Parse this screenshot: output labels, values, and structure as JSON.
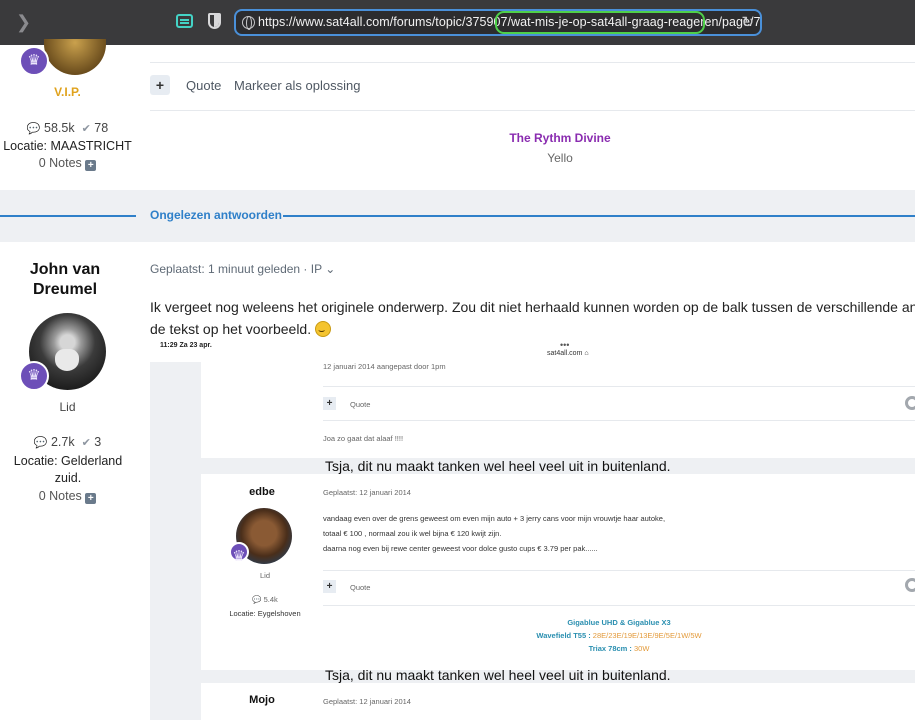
{
  "browser": {
    "url": "https://www.sat4all.com/forums/topic/375907/wat-mis-je-op-sat4all-graag-reageren/page/7",
    "url_prefix": "https://www.sat4all.com/forums/topic/375907/",
    "url_slug": "wat-mis-je-op-sat4all-graag-reageren/",
    "url_suffix": "page/7"
  },
  "prev_post": {
    "rank": "V.I.P.",
    "posts": "58.5k",
    "reputation": "78",
    "location": "Locatie: MAASTRICHT",
    "notes": "0 Notes",
    "actions": {
      "quote": "Quote",
      "mark_solution": "Markeer als oplossing"
    },
    "signature": {
      "line1": "The Rythm Divine",
      "line2": "Yello"
    }
  },
  "separator": {
    "label": "Ongelezen antwoorden"
  },
  "post": {
    "author": "John van Dreumel",
    "role": "Lid",
    "posts": "2.7k",
    "reputation": "3",
    "location": "Locatie: Gelderland zuid.",
    "notes": "0 Notes",
    "meta": "Geplaatst: 1 minuut geleden · IP ⌄",
    "body_line1": "Ik vergeet nog weleens het originele onderwerp. Zou dit niet herhaald kunnen worden op de balk tussen de verschillende antwoorden? K",
    "body_line2": "de tekst op het voorbeeld."
  },
  "screenshot": {
    "time": "11:29  Za 23 apr.",
    "dots": "•••",
    "host": "sat4all.com ⌂",
    "edited_note": "12 januari 2014 aangepast door 1pm",
    "quote": "Quote",
    "reply_text": "Joa zo gaat dat alaaf !!!!",
    "caption": "Tsja, dit nu maakt tanken wel heel veel uit in buitenland.",
    "edbe": {
      "author": "edbe",
      "meta": "Geplaatst: 12 januari 2014",
      "line1": "vandaag even over de grens geweest om even mijn auto + 3 jerry cans voor mijn vrouwtje haar autoke,",
      "line2": "totaal € 100 , normaal zou ik wel bijna € 120 kwijt zijn.",
      "line3": "daarna nog even bij rewe center geweest voor dolce gusto cups € 3.79 per pak......",
      "role": "Lid",
      "posts": "5.4k",
      "location": "Locatie: Eygelshoven",
      "sig_line1": "Gigablue UHD & Gigablue X3",
      "sig_line2_label": "Wavefield T55 : ",
      "sig_line2_value": "28E/23E/19E/13E/9E/5E/1W/5W",
      "sig_line3_label": "Triax 78cm : ",
      "sig_line3_value": "30W"
    },
    "mojo": {
      "author": "Mojo",
      "meta": "Geplaatst: 12 januari 2014"
    }
  },
  "colors": {
    "accent": "#2f80c9",
    "vip": "#e0a21c",
    "signature": "#8a2cb0",
    "url_highlight": "#4fd04a"
  }
}
